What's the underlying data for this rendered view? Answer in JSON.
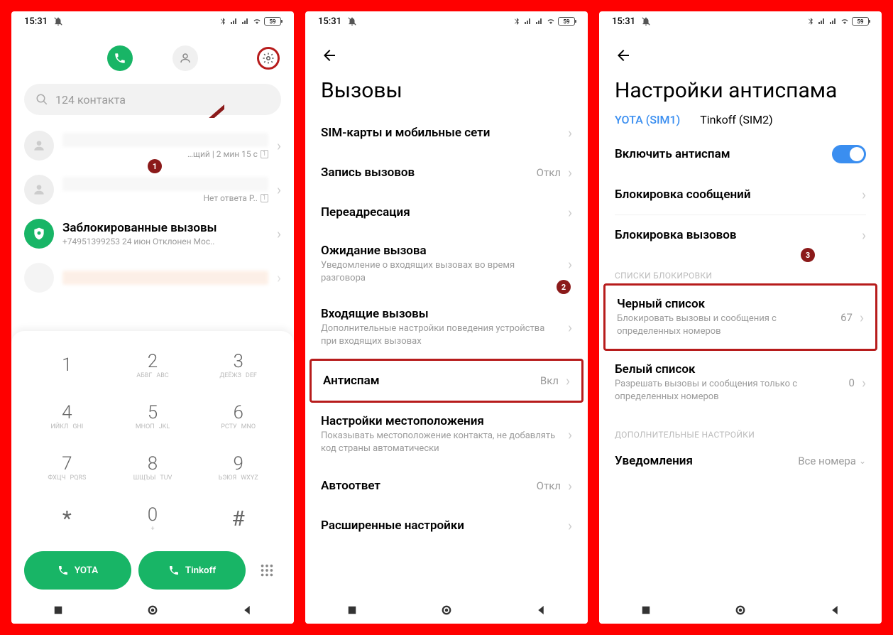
{
  "status": {
    "time": "15:31",
    "battery": "59"
  },
  "screen1": {
    "search_placeholder": "124 контакта",
    "row1_sub": "…щий | 2 мин 15 с",
    "row2_sub": "Нет ответа Р..",
    "blocked_title": "Заблокированные вызовы",
    "blocked_sub": "+74951399253 24 июн Отклонен Мос..",
    "keys": [
      {
        "n": "1",
        "ru": "",
        "en": ""
      },
      {
        "n": "2",
        "ru": "АБВГ",
        "en": "ABC"
      },
      {
        "n": "3",
        "ru": "ДЕЁЖЗ",
        "en": "DEF"
      },
      {
        "n": "4",
        "ru": "ИЙКЛ",
        "en": "GHI"
      },
      {
        "n": "5",
        "ru": "МНОП",
        "en": "JKL"
      },
      {
        "n": "6",
        "ru": "РСТУ",
        "en": "MNO"
      },
      {
        "n": "7",
        "ru": "ФХЦЧ",
        "en": "PQRS"
      },
      {
        "n": "8",
        "ru": "ШЩЪЫ",
        "en": "TUV"
      },
      {
        "n": "9",
        "ru": "ЬЭЮЯ",
        "en": "WXYZ"
      },
      {
        "n": "*",
        "ru": "",
        "en": ""
      },
      {
        "n": "0",
        "ru": "",
        "en": "+"
      },
      {
        "n": "#",
        "ru": "",
        "en": ""
      }
    ],
    "call1": "YOTA",
    "call2": "Tinkoff"
  },
  "screen2": {
    "title": "Вызовы",
    "items": [
      {
        "title": "SIM-карты и мобильные сети"
      },
      {
        "title": "Запись вызовов",
        "val": "Откл"
      },
      {
        "title": "Переадресация"
      },
      {
        "title": "Ожидание вызова",
        "sub": "Уведомление о входящих вызовах во время разговора"
      },
      {
        "title": "Входящие вызовы",
        "sub": "Дополнительные настройки поведения устройства при входящих вызовах"
      },
      {
        "title": "Антиспам",
        "val": "Вкл",
        "hl": true
      },
      {
        "title": "Настройки местоположения",
        "sub": "Показывать местоположение контакта, не добавлять код страны автоматически"
      },
      {
        "title": "Автоответ",
        "val": "Откл"
      },
      {
        "title": "Расширенные настройки"
      }
    ]
  },
  "screen3": {
    "title": "Настройки антиспама",
    "sim1": "YOTA (SIM1)",
    "sim2": "Tinkoff (SIM2)",
    "enable_label": "Включить антиспам",
    "block_msg": "Блокировка сообщений",
    "block_calls": "Блокировка вызовов",
    "section_lists": "СПИСКИ БЛОКИРОВКИ",
    "blacklist": "Черный список",
    "blacklist_sub": "Блокировать вызовы и сообщения с определенных номеров",
    "blacklist_val": "67",
    "whitelist": "Белый список",
    "whitelist_sub": "Разрешать вызовы и сообщения только с определенных номеров",
    "whitelist_val": "0",
    "section_extra": "ДОПОЛНИТЕЛЬНЫЕ НАСТРОЙКИ",
    "notif": "Уведомления",
    "notif_val": "Все номера"
  }
}
